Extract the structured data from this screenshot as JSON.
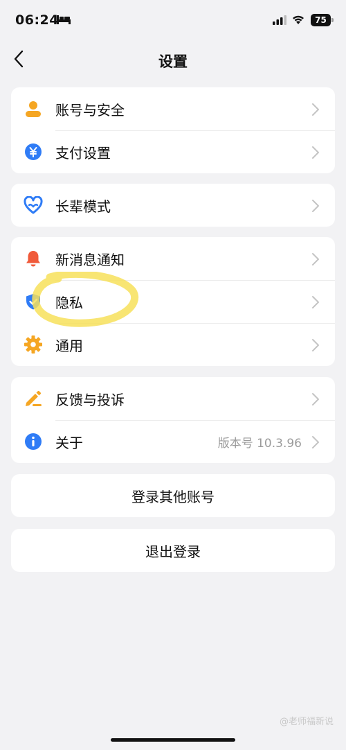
{
  "status_bar": {
    "time": "06:24",
    "battery": "75"
  },
  "nav": {
    "title": "设置"
  },
  "groups": [
    {
      "items": [
        {
          "label": "账号与安全",
          "icon": "person-icon",
          "color": "#f5a623"
        },
        {
          "label": "支付设置",
          "icon": "yuan-icon",
          "color": "#2f7cf6"
        }
      ]
    },
    {
      "items": [
        {
          "label": "长辈模式",
          "icon": "heart-icon",
          "color": "#2f7cf6"
        }
      ]
    },
    {
      "items": [
        {
          "label": "新消息通知",
          "icon": "bell-icon",
          "color": "#f05a3a"
        },
        {
          "label": "隐私",
          "icon": "shield-icon",
          "color": "#2f7cf6"
        },
        {
          "label": "通用",
          "icon": "gear-icon",
          "color": "#f5a623"
        }
      ]
    },
    {
      "items": [
        {
          "label": "反馈与投诉",
          "icon": "pen-icon",
          "color": "#f5a623"
        },
        {
          "label": "关于",
          "icon": "info-icon",
          "color": "#2f7cf6",
          "value": "版本号 10.3.96"
        }
      ]
    }
  ],
  "buttons": {
    "login_other": "登录其他账号",
    "logout": "退出登录"
  },
  "watermark": "@老师福新说",
  "colors": {
    "background": "#f2f2f4",
    "highlight": "#f7e15a"
  }
}
